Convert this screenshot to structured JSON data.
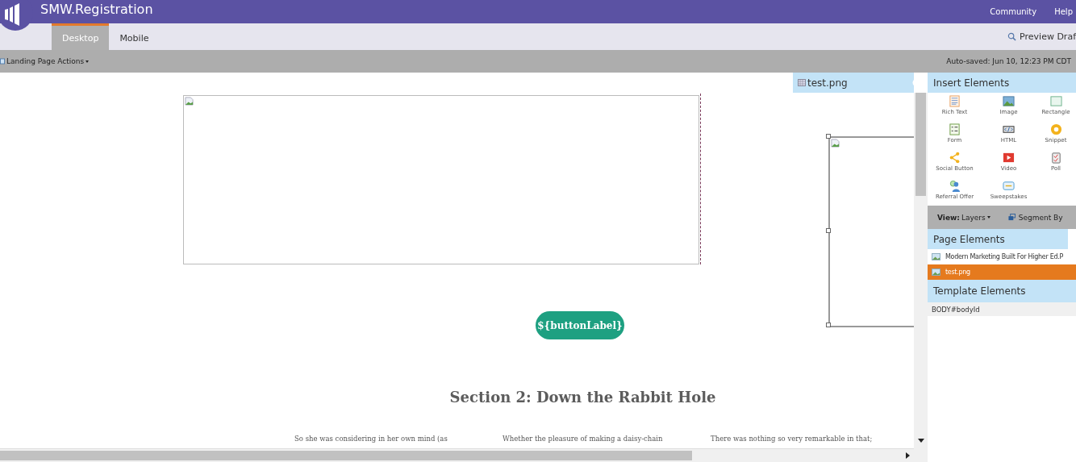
{
  "header": {
    "title": "SMW.Registration",
    "links": [
      "Community",
      "Help"
    ]
  },
  "tabs": [
    {
      "label": "Desktop",
      "selected": true
    },
    {
      "label": "Mobile",
      "selected": false
    }
  ],
  "preview": {
    "label": "Preview Draf"
  },
  "toolbar": {
    "actions": "Landing Page Actions",
    "autosaved": "Auto-saved: Jun 10, 12:23 PM CDT"
  },
  "canvas": {
    "button_label": "${buttonLabel}",
    "heading": "Section 2: Down the Rabbit Hole",
    "paragraphs": [
      "So she was considering in her own mind (as",
      "Whether the pleasure of making a daisy-chain",
      "There was nothing so very remarkable in that;"
    ]
  },
  "selected_element": {
    "title": "test.png"
  },
  "insert_panel": {
    "title": "Insert Elements",
    "items": [
      "Rich Text",
      "Image",
      "Rectangle",
      "Form",
      "HTML",
      "Snippet",
      "Social Button",
      "Video",
      "Poll",
      "Referral Offer",
      "Sweepstakes"
    ]
  },
  "view_bar": {
    "view_label": "View:",
    "view_value": "Layers",
    "segment": "Segment By"
  },
  "page_elements": {
    "title": "Page Elements",
    "items": [
      {
        "label": "Modern Marketing Built For Higher Ed.P",
        "selected": false
      },
      {
        "label": "test.png",
        "selected": true
      }
    ]
  },
  "template_elements": {
    "title": "Template Elements",
    "items": [
      "BODY#bodyId"
    ]
  }
}
